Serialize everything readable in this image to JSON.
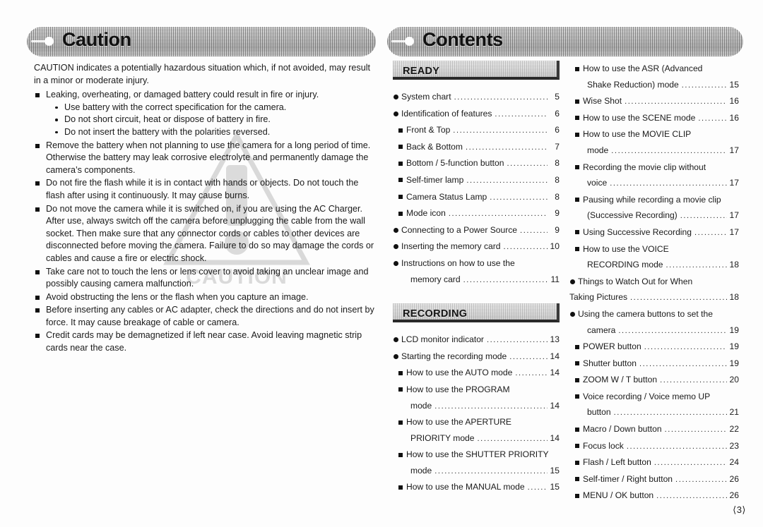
{
  "page": {
    "number_label": "⟨3⟩"
  },
  "left_page": {
    "banner_title": "Caution",
    "intro": "CAUTION indicates a potentially hazardous situation which, if not avoided, may result in a minor or moderate injury.",
    "watermark_text": "CAUTION",
    "watermark_icon": "warning-triangle-icon",
    "items": [
      {
        "text": "Leaking, overheating, or damaged battery could result in fire or injury.",
        "sub": [
          "Use battery with the correct specification for the camera.",
          "Do not short circuit, heat or dispose of battery in fire.",
          "Do not insert the battery with the polarities reversed."
        ]
      },
      {
        "text": "Remove the battery when not planning to use the camera for a long period of time. Otherwise the battery may leak corrosive electrolyte and permanently damage the camera’s components.",
        "sub": []
      },
      {
        "text": "Do not fire the flash while it is in contact with hands or objects. Do not touch the flash after using it continuously. It may cause burns.",
        "sub": []
      },
      {
        "text": "Do not move the camera while it is switched on, if you are using the AC Charger. After use, always switch off the camera before unplugging the cable from the wall socket. Then make sure that any connector cords or cables to other devices are disconnected before moving the camera. Failure to do so may damage the cords or cables and cause a fire or electric shock.",
        "sub": []
      },
      {
        "text": "Take care not to touch the lens or lens cover to avoid taking an unclear image and possibly causing camera malfunction.",
        "sub": []
      },
      {
        "text": "Avoid obstructing the lens or the flash when you capture an image.",
        "sub": []
      },
      {
        "text": "Before inserting any cables or AC adapter, check the directions and do not insert by force. It may cause breakage of cable or camera.",
        "sub": []
      },
      {
        "text": "Credit cards may be demagnetized if left near case. Avoid leaving magnetic strip cards near the case.",
        "sub": []
      }
    ]
  },
  "right_page": {
    "banner_title": "Contents",
    "sections": {
      "ready": "READY",
      "recording": "RECORDING"
    },
    "column_mid": [
      {
        "kind": "section",
        "label": "READY"
      },
      {
        "kind": "entry",
        "level": 1,
        "text": "System chart",
        "page": "5",
        "leader": true
      },
      {
        "kind": "entry",
        "level": 1,
        "text": "Identification of features",
        "page": "6",
        "leader": true
      },
      {
        "kind": "entry",
        "level": 2,
        "text": "Front & Top",
        "page": "6",
        "leader": true
      },
      {
        "kind": "entry",
        "level": 2,
        "text": "Back & Bottom",
        "page": "7",
        "leader": true
      },
      {
        "kind": "entry",
        "level": 2,
        "text": "Bottom / 5-function button",
        "page": "8",
        "leader": true
      },
      {
        "kind": "entry",
        "level": 2,
        "text": "Self-timer lamp",
        "page": "8",
        "leader": true
      },
      {
        "kind": "entry",
        "level": 2,
        "text": "Camera Status Lamp",
        "page": "8",
        "leader": true
      },
      {
        "kind": "entry",
        "level": 2,
        "text": "Mode icon",
        "page": "9",
        "leader": true
      },
      {
        "kind": "entry",
        "level": 1,
        "text": "Connecting to a Power Source",
        "page": "9",
        "leader": true
      },
      {
        "kind": "entry",
        "level": 1,
        "text": "Inserting the memory card",
        "page": "10",
        "leader": true
      },
      {
        "kind": "entry",
        "level": 1,
        "text": "Instructions on how to use the",
        "page": "",
        "leader": false
      },
      {
        "kind": "entry",
        "level": 0,
        "indent": "cont",
        "text": "memory card",
        "page": "11",
        "leader": true
      },
      {
        "kind": "gap"
      },
      {
        "kind": "section",
        "label": "RECORDING"
      },
      {
        "kind": "entry",
        "level": 1,
        "text": "LCD monitor indicator",
        "page": "13",
        "leader": true
      },
      {
        "kind": "entry",
        "level": 1,
        "text": "Starting the recording mode",
        "page": "14",
        "leader": true
      },
      {
        "kind": "entry",
        "level": 2,
        "text": "How to use the AUTO mode",
        "page": "14",
        "leader": true
      },
      {
        "kind": "entry",
        "level": 2,
        "text": "How to use the PROGRAM",
        "page": "",
        "leader": false
      },
      {
        "kind": "entry",
        "level": 0,
        "indent": "cont",
        "text": "mode",
        "page": "14",
        "leader": true
      },
      {
        "kind": "entry",
        "level": 2,
        "text": "How to use the APERTURE",
        "page": "",
        "leader": false
      },
      {
        "kind": "entry",
        "level": 0,
        "indent": "cont",
        "text": "PRIORITY mode",
        "page": "14",
        "leader": true
      },
      {
        "kind": "entry",
        "level": 2,
        "text": "How to use the SHUTTER PRIORITY",
        "page": "",
        "leader": false
      },
      {
        "kind": "entry",
        "level": 0,
        "indent": "cont",
        "text": "mode",
        "page": "15",
        "leader": true
      },
      {
        "kind": "entry",
        "level": 2,
        "text": "How to use the MANUAL mode",
        "page": "15",
        "leader": true
      }
    ],
    "column_right": [
      {
        "kind": "entry",
        "level": 2,
        "text": "How to use the ASR (Advanced",
        "page": "",
        "leader": false
      },
      {
        "kind": "entry",
        "level": 0,
        "indent": "cont",
        "text": "Shake Reduction) mode",
        "page": "15",
        "leader": true
      },
      {
        "kind": "entry",
        "level": 2,
        "text": "Wise Shot",
        "page": "16",
        "leader": true
      },
      {
        "kind": "entry",
        "level": 2,
        "text": "How to use the SCENE mode",
        "page": "16",
        "leader": true
      },
      {
        "kind": "entry",
        "level": 2,
        "text": "How to use the MOVIE CLIP",
        "page": "",
        "leader": false
      },
      {
        "kind": "entry",
        "level": 0,
        "indent": "cont",
        "text": "mode",
        "page": "17",
        "leader": true
      },
      {
        "kind": "entry",
        "level": 2,
        "text": "Recording the movie clip without",
        "page": "",
        "leader": false
      },
      {
        "kind": "entry",
        "level": 0,
        "indent": "cont",
        "text": "voice",
        "page": "17",
        "leader": true
      },
      {
        "kind": "entry",
        "level": 2,
        "text": "Pausing while recording a movie clip",
        "page": "",
        "leader": false
      },
      {
        "kind": "entry",
        "level": 0,
        "indent": "cont",
        "text": "(Successive Recording)",
        "page": "17",
        "leader": true
      },
      {
        "kind": "entry",
        "level": 2,
        "text": "Using Successive Recording",
        "page": "17",
        "leader": true
      },
      {
        "kind": "entry",
        "level": 2,
        "text": "How to use the VOICE",
        "page": "",
        "leader": false
      },
      {
        "kind": "entry",
        "level": 0,
        "indent": "cont",
        "text": "RECORDING mode",
        "page": "18",
        "leader": true
      },
      {
        "kind": "entry",
        "level": 1,
        "text": "Things to Watch Out for When",
        "page": "",
        "leader": false
      },
      {
        "kind": "entry",
        "level": 0,
        "indent": "flush",
        "text": "Taking Pictures",
        "page": "18",
        "leader": true
      },
      {
        "kind": "entry",
        "level": 1,
        "text": "Using the camera buttons to set the",
        "page": "",
        "leader": false
      },
      {
        "kind": "entry",
        "level": 0,
        "indent": "cont",
        "text": "camera",
        "page": "19",
        "leader": true
      },
      {
        "kind": "entry",
        "level": 2,
        "text": "POWER button",
        "page": "19",
        "leader": true
      },
      {
        "kind": "entry",
        "level": 2,
        "text": "Shutter button",
        "page": "19",
        "leader": true
      },
      {
        "kind": "entry",
        "level": 2,
        "text": "ZOOM W / T button",
        "page": "20",
        "leader": true
      },
      {
        "kind": "entry",
        "level": 2,
        "text": "Voice recording / Voice memo UP",
        "page": "",
        "leader": false
      },
      {
        "kind": "entry",
        "level": 0,
        "indent": "cont",
        "text": "button",
        "page": "21",
        "leader": true
      },
      {
        "kind": "entry",
        "level": 2,
        "text": "Macro / Down button",
        "page": "22",
        "leader": true
      },
      {
        "kind": "entry",
        "level": 2,
        "text": "Focus lock",
        "page": "23",
        "leader": true
      },
      {
        "kind": "entry",
        "level": 2,
        "text": "Flash / Left button",
        "page": "24",
        "leader": true
      },
      {
        "kind": "entry",
        "level": 2,
        "text": "Self-timer / Right button",
        "page": "26",
        "leader": true
      },
      {
        "kind": "entry",
        "level": 2,
        "text": "MENU / OK button",
        "page": "26",
        "leader": true
      }
    ]
  }
}
